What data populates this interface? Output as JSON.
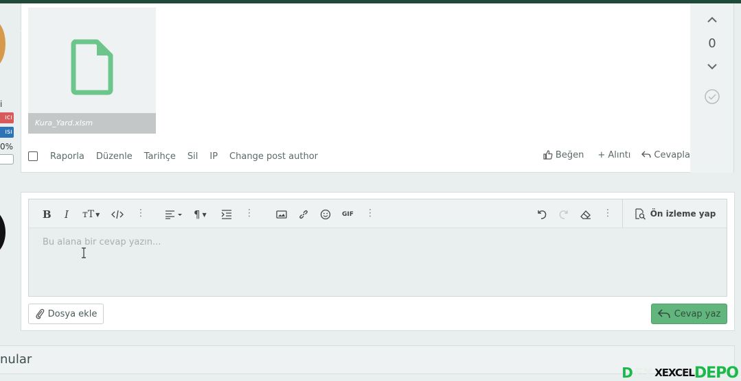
{
  "post": {
    "user_fragment": "i",
    "badge_red": "ıcı",
    "badge_blue": "ısı",
    "percent": "0%",
    "attachment": {
      "filename": "Kura_Yard.xlsm"
    },
    "actions": {
      "report": "Raporla",
      "edit": "Düzenle",
      "history": "Tarihçe",
      "delete": "Sil",
      "ip": "IP",
      "change_author": "Change post author"
    },
    "reactions": {
      "like": "Beğen",
      "quote": "+ Alıntı",
      "reply": "Cevapla"
    },
    "votes": {
      "count": "0"
    }
  },
  "editor": {
    "placeholder": "Bu alana bir cevap yazın...",
    "preview_label": "Ön izleme yap",
    "gif_label": "GIF",
    "attach_label": "Dosya ekle",
    "submit_label": "Cevap yaz"
  },
  "similar": {
    "title": "nular"
  },
  "watermark": {
    "d": "D",
    "mid": "EY",
    "excel": "XEXCEL",
    "depo": "DEPO"
  },
  "colors": {
    "accent_green": "#62b67d",
    "file_icon_green": "#6cc58a",
    "badge_red": "#d95a5a",
    "badge_blue": "#2c73b8",
    "top_bar": "#1f4a3a"
  }
}
